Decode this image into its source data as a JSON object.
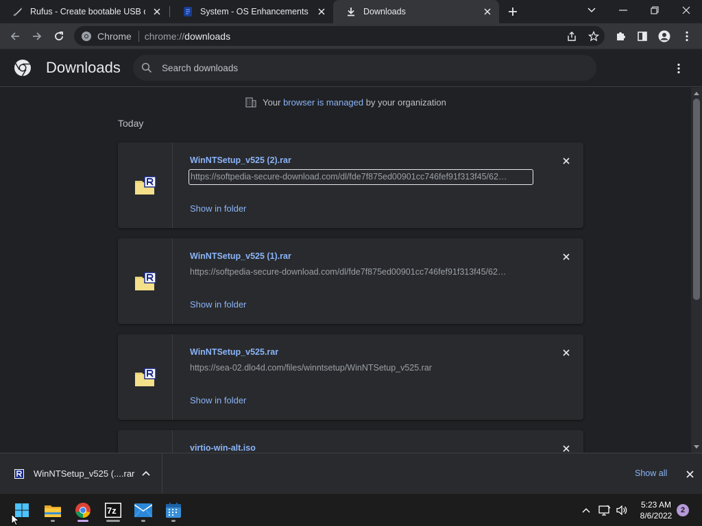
{
  "tabs": [
    {
      "title": "Rufus - Create bootable USB drive",
      "favicon": "rufus-icon",
      "active": false
    },
    {
      "title": "System - OS Enhancements Downloads",
      "favicon": "softpedia-icon",
      "active": false
    },
    {
      "title": "Downloads",
      "favicon": "download-icon",
      "active": true
    }
  ],
  "toolbar": {
    "site_chip": "Chrome",
    "url_scheme": "chrome://",
    "url_host": "downloads"
  },
  "header": {
    "title": "Downloads",
    "search_placeholder": "Search downloads"
  },
  "managed": {
    "prefix": "Your",
    "link": "browser is managed",
    "suffix": "by your organization"
  },
  "section_label": "Today",
  "downloads": [
    {
      "name": "WinNTSetup_v525 (2).rar",
      "url": "https://softpedia-secure-download.com/dl/fde7f875ed00901cc746fef91f313f45/62…",
      "action": "Show in folder",
      "focused": true
    },
    {
      "name": "WinNTSetup_v525 (1).rar",
      "url": "https://softpedia-secure-download.com/dl/fde7f875ed00901cc746fef91f313f45/62…",
      "action": "Show in folder",
      "focused": false
    },
    {
      "name": "WinNTSetup_v525.rar",
      "url": "https://sea-02.dlo4d.com/files/winntsetup/WinNTSetup_v525.rar",
      "action": "Show in folder",
      "focused": false
    },
    {
      "name": "virtio-win-alt.iso",
      "url": "",
      "action": "",
      "focused": false
    }
  ],
  "shelf": {
    "file": "WinNTSetup_v525 (....rar",
    "show_all": "Show all"
  },
  "taskbar": {
    "apps": [
      "windows-start-icon",
      "file-explorer-icon",
      "chrome-icon",
      "7zip-icon",
      "mail-icon",
      "calendar-icon"
    ],
    "time": "5:23 AM",
    "date": "8/6/2022",
    "notifications": "2"
  },
  "colors": {
    "accent": "#8ab4f8",
    "background": "#202124",
    "card": "#292a2d"
  }
}
